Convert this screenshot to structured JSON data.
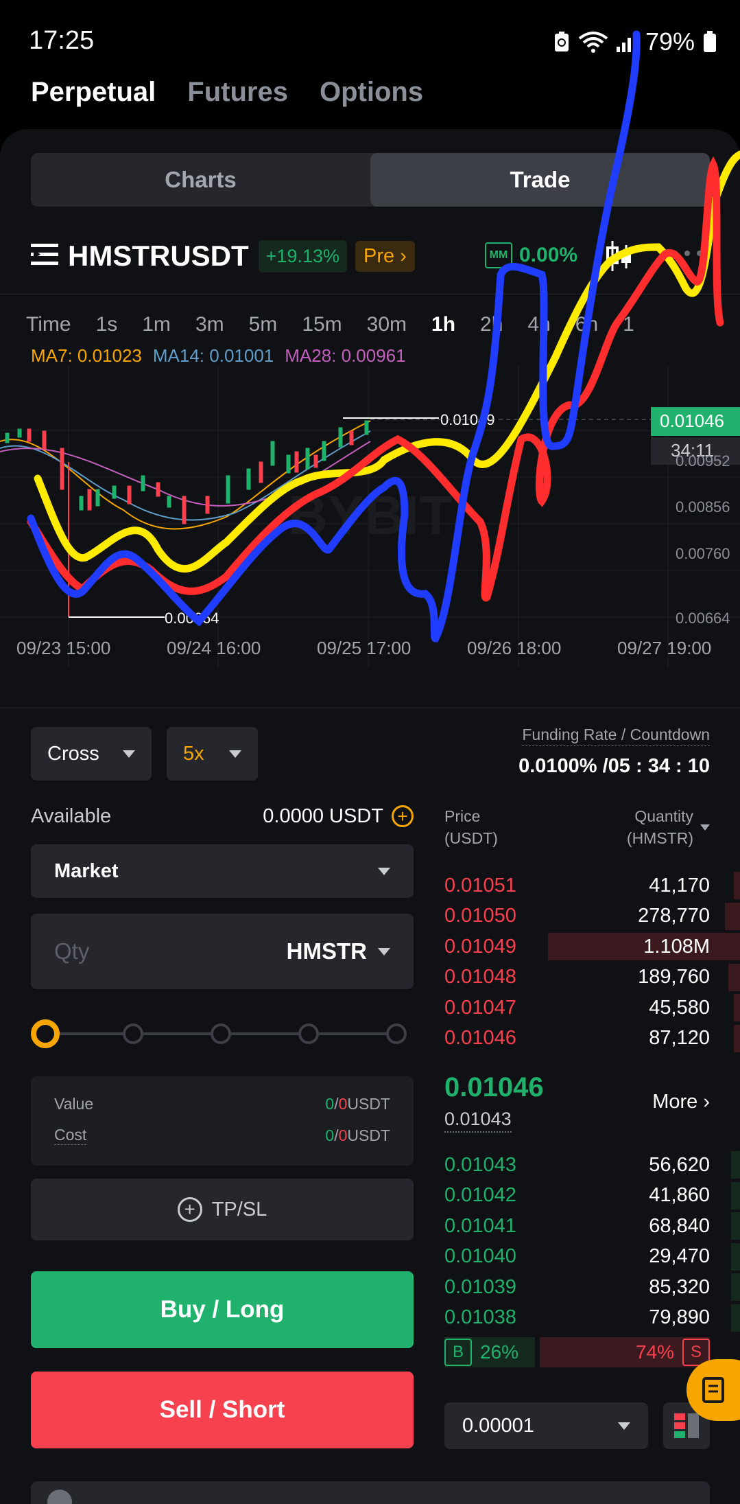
{
  "status_bar": {
    "time": "17:25",
    "battery": "79%"
  },
  "product_tabs": [
    {
      "label": "Perpetual",
      "active": true
    },
    {
      "label": "Futures",
      "active": false
    },
    {
      "label": "Options",
      "active": false
    }
  ],
  "view_toggle": {
    "charts": "Charts",
    "trade": "Trade",
    "active": "trade"
  },
  "symbol": {
    "name": "HMSTRUSDT",
    "change": "+19.13%",
    "pre_label": "Pre",
    "mm_label": "MM",
    "mm_value": "0.00%"
  },
  "intervals": {
    "items": [
      "Time",
      "1s",
      "1m",
      "3m",
      "5m",
      "15m",
      "30m",
      "1h",
      "2h",
      "4h",
      "6h",
      "1"
    ],
    "active": "1h"
  },
  "ma": {
    "ma7": "MA7: 0.01023",
    "ma14": "MA14: 0.01001",
    "ma28": "MA28: 0.00961",
    "colors": {
      "ma7": "#f7a600",
      "ma14": "#5f9dc8",
      "ma28": "#c35fbd"
    }
  },
  "chart": {
    "high_label": "0.01049",
    "low_label": "0.00664",
    "last_price": "0.01046",
    "countdown": "34:11",
    "y_ticks": [
      "0.00952",
      "0.00856",
      "0.00760",
      "0.00664"
    ],
    "x_ticks": [
      "09/23 15:00",
      "09/24 16:00",
      "09/25 17:00",
      "09/26 18:00",
      "09/27 19:00"
    ],
    "watermark": "BYBIT"
  },
  "order_form": {
    "margin_mode": "Cross",
    "leverage": "5x",
    "available_label": "Available",
    "available_value": "0.0000 USDT",
    "order_type": "Market",
    "qty_placeholder": "Qty",
    "qty_unit": "HMSTR",
    "slider_progress": 0,
    "value_label": "Value",
    "value_long": "0",
    "value_sep": "/",
    "value_short": "0",
    "value_unit": "USDT",
    "cost_label": "Cost",
    "cost_long": "0",
    "cost_sep": "/",
    "cost_short": "0",
    "cost_unit": "USDT",
    "tpsl_label": "TP/SL",
    "buy_label": "Buy / Long",
    "sell_label": "Sell / Short"
  },
  "funding": {
    "label": "Funding Rate / Countdown",
    "value": "0.0100% /05 : 34 : 10"
  },
  "orderbook": {
    "price_header": "Price",
    "price_unit": "(USDT)",
    "qty_header": "Quantity",
    "qty_unit": "(HMSTR)",
    "asks": [
      {
        "price": "0.01051",
        "qty": "41,170",
        "depth": 0.02
      },
      {
        "price": "0.01050",
        "qty": "278,770",
        "depth": 0.05
      },
      {
        "price": "0.01049",
        "qty": "1.108M",
        "depth": 0.65
      },
      {
        "price": "0.01048",
        "qty": "189,760",
        "depth": 0.04
      },
      {
        "price": "0.01047",
        "qty": "45,580",
        "depth": 0.02
      },
      {
        "price": "0.01046",
        "qty": "87,120",
        "depth": 0.02
      }
    ],
    "mid_price": "0.01046",
    "mark_price": "0.01043",
    "more_label": "More",
    "bids": [
      {
        "price": "0.01043",
        "qty": "56,620",
        "depth": 0.03
      },
      {
        "price": "0.01042",
        "qty": "41,860",
        "depth": 0.03
      },
      {
        "price": "0.01041",
        "qty": "68,840",
        "depth": 0.03
      },
      {
        "price": "0.01040",
        "qty": "29,470",
        "depth": 0.03
      },
      {
        "price": "0.01039",
        "qty": "85,320",
        "depth": 0.03
      },
      {
        "price": "0.01038",
        "qty": "79,890",
        "depth": 0.03
      }
    ],
    "buy_letter": "B",
    "buy_ratio": "26%",
    "sell_ratio": "74%",
    "sell_letter": "S",
    "precision": "0.00001"
  },
  "colors": {
    "green": "#20b26c",
    "red": "#f7414e",
    "accent": "#f7a600"
  }
}
